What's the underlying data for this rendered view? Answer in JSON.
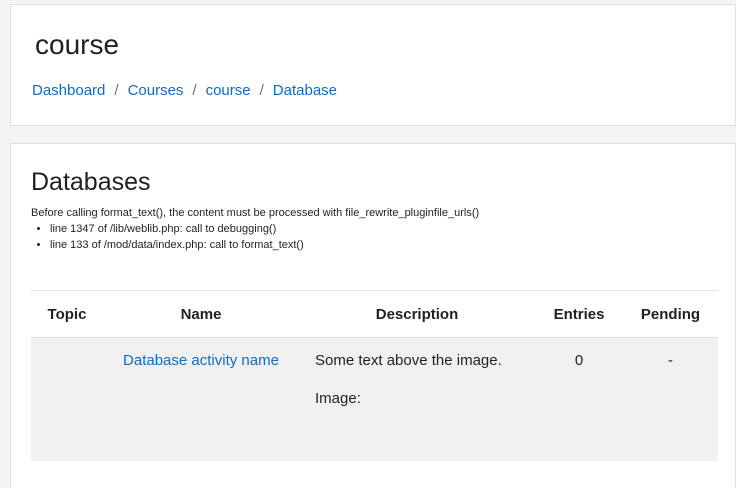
{
  "header": {
    "title": "course",
    "breadcrumb": [
      "Dashboard",
      "Courses",
      "course",
      "Database"
    ],
    "separator": "/"
  },
  "main": {
    "heading": "Databases",
    "debug": {
      "message": "Before calling format_text(), the content must be processed with file_rewrite_pluginfile_urls()",
      "trace": [
        "line 1347 of /lib/weblib.php: call to debugging()",
        "line 133 of /mod/data/index.php: call to format_text()"
      ]
    },
    "table": {
      "headers": [
        "Topic",
        "Name",
        "Description",
        "Entries",
        "Pending"
      ],
      "rows": [
        {
          "topic": "",
          "name": "Database activity name",
          "description": [
            "Some text above the image.",
            "Image:"
          ],
          "entries": "0",
          "pending": "-"
        }
      ]
    }
  },
  "colors": {
    "link": "#0f6cbf",
    "row_bg": "#f0f0f0",
    "page_bg": "#f4f4f4"
  }
}
